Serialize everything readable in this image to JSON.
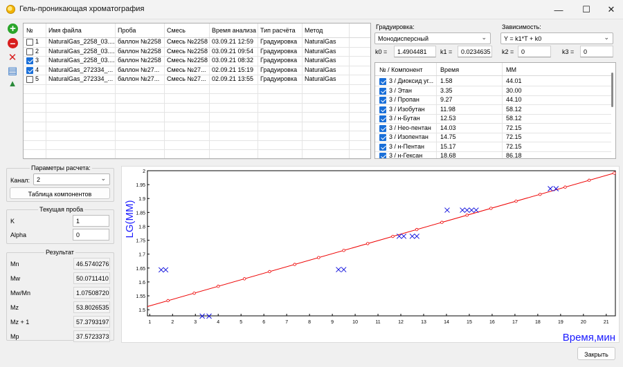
{
  "window": {
    "title": "Гель-проникающая хроматография",
    "minimize_glyph": "—",
    "maximize_glyph": "☐",
    "close_glyph": "✕"
  },
  "toolbar": {
    "buttons": [
      {
        "icon": "add-icon",
        "glyph": "+",
        "color": "#2aa52a"
      },
      {
        "icon": "remove-icon",
        "glyph": "−",
        "color": "#d81e1e"
      },
      {
        "icon": "delete-icon",
        "glyph": "✕",
        "color": "#d81e1e"
      },
      {
        "icon": "save-icon",
        "glyph": "▤",
        "color": "#2f74c8"
      },
      {
        "icon": "chromatogram-icon",
        "glyph": "▲",
        "color": "#2a8a3a"
      }
    ]
  },
  "files_table": {
    "headers": [
      "№",
      "Имя файла",
      "Проба",
      "Смесь",
      "Время анализа",
      "Тип расчёта",
      "Метод"
    ],
    "rows": [
      {
        "checked": false,
        "num": "1",
        "file": "NaturalGas_2258_03....",
        "sample": "баллон №2258",
        "mix": "Смесь №2258",
        "time": "03.09.21 12:59",
        "calc": "Градуировка",
        "method": "NaturalGas"
      },
      {
        "checked": false,
        "num": "2",
        "file": "NaturalGas_2258_03....",
        "sample": "баллон №2258",
        "mix": "Смесь №2258",
        "time": "03.09.21 09:54",
        "calc": "Градуировка",
        "method": "NaturalGas"
      },
      {
        "checked": true,
        "num": "3",
        "file": "NaturalGas_2258_03....",
        "sample": "баллон №2258",
        "mix": "Смесь №2258",
        "time": "03.09.21 08:32",
        "calc": "Градуировка",
        "method": "NaturalGas"
      },
      {
        "checked": true,
        "num": "4",
        "file": "NaturalGas_272334_...",
        "sample": "баллон №27...",
        "mix": "Смесь №27...",
        "time": "02.09.21 15:19",
        "calc": "Градуировка",
        "method": "NaturalGas"
      },
      {
        "checked": false,
        "num": "5",
        "file": "NaturalGas_272334_...",
        "sample": "баллон №27...",
        "mix": "Смесь №27...",
        "time": "02.09.21 13:55",
        "calc": "Градуировка",
        "method": "NaturalGas"
      }
    ]
  },
  "calibration": {
    "label": "Градуировка:",
    "value": "Монодисперсный",
    "dependence_label": "Зависимость:",
    "dependence_value": "Y = k1*T + k0",
    "k0_label": "k0 =",
    "k0": "1.4904481",
    "k1_label": "k1 =",
    "k1": "0.0234635",
    "k2_label": "k2 =",
    "k2": "0",
    "k3_label": "k3 =",
    "k3": "0"
  },
  "components_table": {
    "headers": [
      "№ / Компонент",
      "Время",
      "ММ"
    ],
    "rows": [
      {
        "checked": true,
        "name": "3 / Диоксид уг...",
        "time": "1.58",
        "mm": "44.01"
      },
      {
        "checked": true,
        "name": "3 / Этан",
        "time": "3.35",
        "mm": "30.00"
      },
      {
        "checked": true,
        "name": "3 / Пропан",
        "time": "9.27",
        "mm": "44.10"
      },
      {
        "checked": true,
        "name": "3 / Изобутан",
        "time": "11.98",
        "mm": "58.12"
      },
      {
        "checked": true,
        "name": "3 / н-Бутан",
        "time": "12.53",
        "mm": "58.12"
      },
      {
        "checked": true,
        "name": "3 / Нео-пентан",
        "time": "14.03",
        "mm": "72.15"
      },
      {
        "checked": true,
        "name": "3 / Изопентан",
        "time": "14.75",
        "mm": "72.15"
      },
      {
        "checked": true,
        "name": "3 / н-Пентан",
        "time": "15.17",
        "mm": "72.15"
      },
      {
        "checked": true,
        "name": "3 / н-Гексан",
        "time": "18.68",
        "mm": "86.18"
      }
    ]
  },
  "calc_params": {
    "title": "Параметры расчета:",
    "channel_label": "Канал:",
    "channel_value": "2",
    "components_button": "Таблица компонентов"
  },
  "current_sample": {
    "title": "Текущая проба",
    "k_label": "K",
    "k_value": "1",
    "alpha_label": "Alpha",
    "alpha_value": "0"
  },
  "result": {
    "title": "Результат",
    "rows": [
      {
        "label": "Mn",
        "value": "46.5740276"
      },
      {
        "label": "Mw",
        "value": "50.0711410"
      },
      {
        "label": "Mw/Mn",
        "value": "1.07508720"
      },
      {
        "label": "Mz",
        "value": "53.8026535"
      },
      {
        "label": "Mz + 1",
        "value": "57.3793197"
      },
      {
        "label": "Mp",
        "value": "37.5723373"
      }
    ]
  },
  "close_button": "Закрыть",
  "colors": {
    "fit_line": "#ee0000",
    "points": "#1010dd",
    "axis_label": "#1a1aff"
  },
  "chart_data": {
    "type": "scatter",
    "ylabel": "LG(MM)",
    "xlabel": "Время,мин",
    "xlim": [
      0.9,
      21.4
    ],
    "ylim": [
      1.478,
      2.0
    ],
    "grid": false,
    "xticks": [
      1,
      2,
      3,
      4,
      5,
      6,
      7,
      8,
      9,
      10,
      11,
      12,
      13,
      14,
      15,
      16,
      17,
      18,
      19,
      20,
      21
    ],
    "yticks": [
      1.5,
      1.55,
      1.6,
      1.65,
      1.7,
      1.75,
      1.8,
      1.85,
      1.9,
      1.95,
      2
    ],
    "ytick_labels": [
      "1.5",
      "1.55",
      "1.6",
      "1.65",
      "1.7",
      "1.75",
      "1.8",
      "1.85",
      "1.9",
      "1.95",
      "2"
    ],
    "series": [
      {
        "kind": "fit_line",
        "k0": 1.4904481,
        "k1": 0.0234635,
        "marker_x": [
          1.8,
          2.95,
          4.0,
          5.15,
          6.25,
          7.35,
          8.4,
          9.5,
          10.55,
          11.65,
          12.7,
          13.8,
          14.9,
          15.95,
          17.05,
          18.1,
          19.2,
          20.25,
          21.35
        ]
      },
      {
        "kind": "points",
        "x": [
          1.5,
          1.7,
          3.3,
          3.6,
          9.27,
          9.5,
          11.93,
          12.13,
          12.5,
          12.7,
          14.03,
          14.7,
          14.9,
          15.1,
          15.3,
          18.55,
          18.8
        ],
        "y": [
          1.6435,
          1.6435,
          1.4771,
          1.4771,
          1.6444,
          1.6444,
          1.7643,
          1.7643,
          1.7643,
          1.7643,
          1.8582,
          1.8582,
          1.8582,
          1.8582,
          1.8582,
          1.9354,
          1.9354
        ]
      }
    ]
  }
}
